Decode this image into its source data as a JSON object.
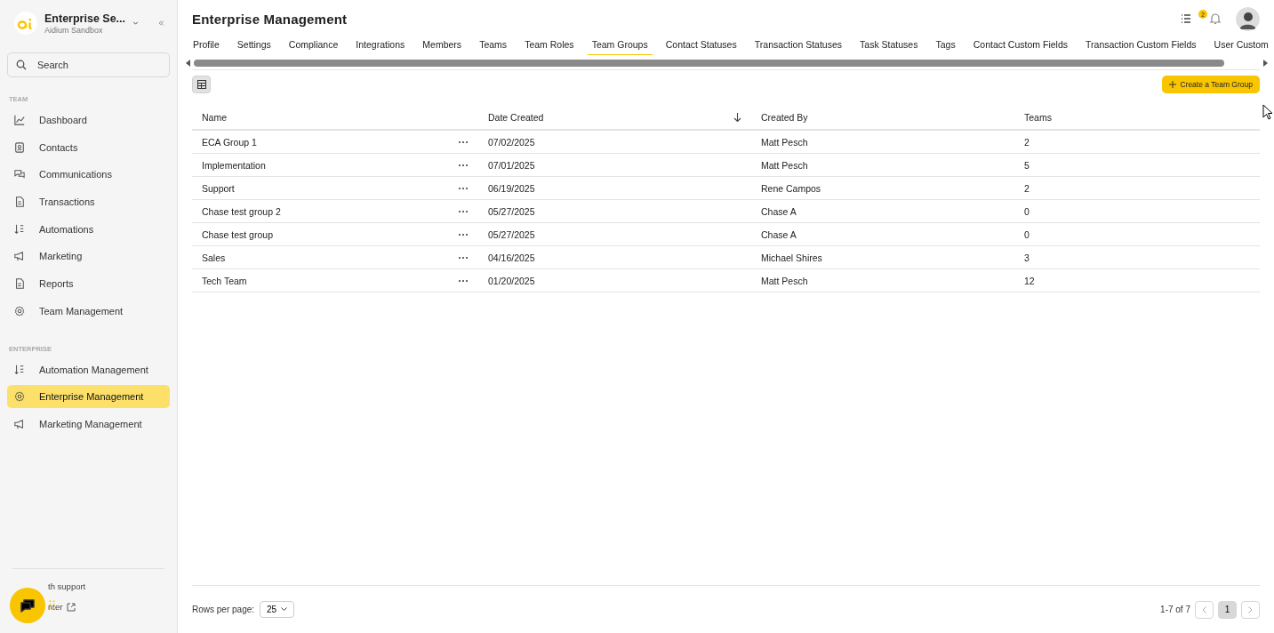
{
  "org": {
    "name": "Enterprise Se...",
    "subtitle": "Aidium Sandbox"
  },
  "search": {
    "placeholder": "Search"
  },
  "sidebar": {
    "sections": [
      {
        "title": "TEAM",
        "items": [
          {
            "label": "Dashboard",
            "kind": "chart",
            "selected": false
          },
          {
            "label": "Contacts",
            "kind": "contact",
            "selected": false
          },
          {
            "label": "Communications",
            "kind": "chat",
            "selected": false
          },
          {
            "label": "Transactions",
            "kind": "doc",
            "selected": false
          },
          {
            "label": "Automations",
            "kind": "sort",
            "selected": false
          },
          {
            "label": "Marketing",
            "kind": "megaphone",
            "selected": false
          },
          {
            "label": "Reports",
            "kind": "doc",
            "selected": false
          },
          {
            "label": "Team Management",
            "kind": "gear",
            "selected": false
          }
        ]
      },
      {
        "title": "ENTERPRISE",
        "items": [
          {
            "label": "Automation Management",
            "kind": "sort",
            "selected": false
          },
          {
            "label": "Enterprise Management",
            "kind": "gear",
            "selected": true
          },
          {
            "label": "Marketing Management",
            "kind": "megaphone",
            "selected": false
          }
        ]
      }
    ]
  },
  "support": {
    "line_1": "th support",
    "line_2": "nter"
  },
  "page": {
    "title": "Enterprise Management",
    "notification_count": "2"
  },
  "tabs": [
    {
      "label": "Profile",
      "selected": false
    },
    {
      "label": "Settings",
      "selected": false
    },
    {
      "label": "Compliance",
      "selected": false
    },
    {
      "label": "Integrations",
      "selected": false
    },
    {
      "label": "Members",
      "selected": false
    },
    {
      "label": "Teams",
      "selected": false
    },
    {
      "label": "Team Roles",
      "selected": false
    },
    {
      "label": "Team Groups",
      "selected": true
    },
    {
      "label": "Contact Statuses",
      "selected": false
    },
    {
      "label": "Transaction Statuses",
      "selected": false
    },
    {
      "label": "Task Statuses",
      "selected": false
    },
    {
      "label": "Tags",
      "selected": false
    },
    {
      "label": "Contact Custom Fields",
      "selected": false
    },
    {
      "label": "Transaction Custom Fields",
      "selected": false
    },
    {
      "label": "User Custom",
      "selected": false
    }
  ],
  "create_button": {
    "label": "Create a Team Group"
  },
  "table": {
    "columns": [
      "Name",
      "Date Created",
      "Created By",
      "Teams"
    ],
    "rows": [
      [
        "ECA Group 1",
        "07/02/2025",
        "Matt Pesch",
        "2"
      ],
      [
        "Implementation",
        "07/01/2025",
        "Matt Pesch",
        "5"
      ],
      [
        "Support",
        "06/19/2025",
        "Rene Campos",
        "2"
      ],
      [
        "Chase test group 2",
        "05/27/2025",
        "Chase A",
        "0"
      ],
      [
        "Chase test group",
        "05/27/2025",
        "Chase A",
        "0"
      ],
      [
        "Sales",
        "04/16/2025",
        "Michael Shires",
        "3"
      ],
      [
        "Tech Team",
        "01/20/2025",
        "Matt Pesch",
        "12"
      ]
    ]
  },
  "pagination": {
    "rows_per_page_label": "Rows per page:",
    "rows_per_page": "25",
    "range": "1-7 of 7",
    "pages": [
      {
        "label": "1",
        "selected": true
      }
    ]
  }
}
